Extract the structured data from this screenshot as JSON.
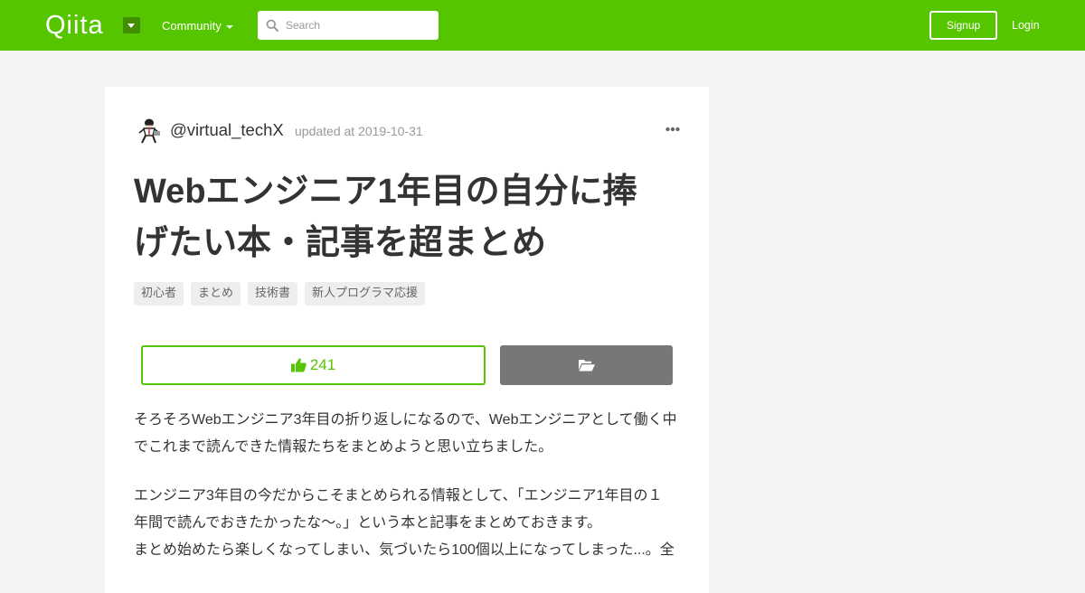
{
  "header": {
    "logo": "Qiita",
    "community_label": "Community",
    "search_placeholder": "Search",
    "signup_label": "Signup",
    "login_label": "Login",
    "brand_color": "#55c500"
  },
  "article": {
    "author": "@virtual_techX",
    "updated": "updated at 2019-10-31",
    "title_lines": [
      "Webエンジニア1年目の自分に捧",
      "げたい本・記事を超まとめ"
    ],
    "tags": [
      "初心者",
      "まとめ",
      "技術書",
      "新人プログラマ応援"
    ],
    "likes": "241",
    "paragraphs": [
      [
        "そろそろWebエンジニア3年目の折り返しになるので、Webエンジニアとして働く中",
        "でこれまで読んできた情報たちをまとめようと思い立ちました。"
      ],
      [
        "エンジニア3年目の今だからこそまとめられる情報として、「エンジニア1年目の１",
        "年間で読んでおきたかったな〜。」という本と記事をまとめておきます。",
        "まとめ始めたら楽しくなってしまい、気づいたら100個以上になってしまった...。全"
      ]
    ]
  },
  "icons": {
    "search": "search-icon",
    "more": "more-icon",
    "like": "thumbs-up-icon",
    "stock": "folder-open-icon"
  }
}
